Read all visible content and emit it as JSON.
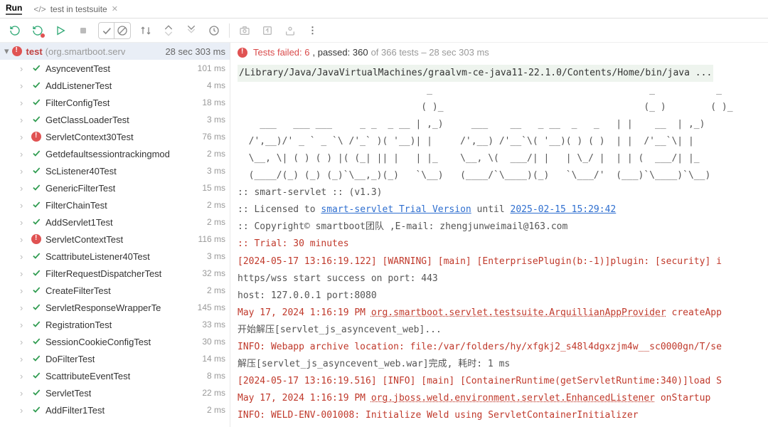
{
  "tabs": {
    "run": "Run",
    "file": "test in testsuite"
  },
  "header": {
    "title": "test",
    "package": "(org.smartboot.serv",
    "time": "28 sec 303 ms"
  },
  "summary": {
    "failed": "Tests failed: 6",
    "passed": ", passed: 360",
    "rest": " of 366 tests – 28 sec 303 ms"
  },
  "tests": [
    {
      "name": "AsynceventTest",
      "time": "101 ms",
      "status": "pass"
    },
    {
      "name": "AddListenerTest",
      "time": "4 ms",
      "status": "pass"
    },
    {
      "name": "FilterConfigTest",
      "time": "18 ms",
      "status": "pass"
    },
    {
      "name": "GetClassLoaderTest",
      "time": "3 ms",
      "status": "pass"
    },
    {
      "name": "ServletContext30Test",
      "time": "76 ms",
      "status": "fail"
    },
    {
      "name": "Getdefaultsessiontrackingmod",
      "time": "2 ms",
      "status": "pass"
    },
    {
      "name": "ScListener40Test",
      "time": "3 ms",
      "status": "pass"
    },
    {
      "name": "GenericFilterTest",
      "time": "15 ms",
      "status": "pass"
    },
    {
      "name": "FilterChainTest",
      "time": "2 ms",
      "status": "pass"
    },
    {
      "name": "AddServlet1Test",
      "time": "2 ms",
      "status": "pass"
    },
    {
      "name": "ServletContextTest",
      "time": "116 ms",
      "status": "fail"
    },
    {
      "name": "ScattributeListener40Test",
      "time": "3 ms",
      "status": "pass"
    },
    {
      "name": "FilterRequestDispatcherTest",
      "time": "32 ms",
      "status": "pass"
    },
    {
      "name": "CreateFilterTest",
      "time": "2 ms",
      "status": "pass"
    },
    {
      "name": "ServletResponseWrapperTe",
      "time": "145 ms",
      "status": "pass"
    },
    {
      "name": "RegistrationTest",
      "time": "33 ms",
      "status": "pass"
    },
    {
      "name": "SessionCookieConfigTest",
      "time": "30 ms",
      "status": "pass"
    },
    {
      "name": "DoFilterTest",
      "time": "14 ms",
      "status": "pass"
    },
    {
      "name": "ScattributeEventTest",
      "time": "8 ms",
      "status": "pass"
    },
    {
      "name": "ServletTest",
      "time": "22 ms",
      "status": "pass"
    },
    {
      "name": "AddFilter1Test",
      "time": "2 ms",
      "status": "pass"
    }
  ],
  "console": {
    "cmd": "/Library/Java/JavaVirtualMachines/graalvm-ce-java11-22.1.0/Contents/Home/bin/java ...",
    "ascii": "                                  _                                       _           _\n                                 ( )_                                    (_ )        ( )_\n    ___   ___ ___     _ _  _ __ | ,_)     ___    __   _ __  _   _   | |    __  | ,_)\n  /',__)/' _ ` _ `\\ /'_` )( '__)| |     /',__) /'__`\\( '__)( ) ( )  | |  /'__`\\| |\n  \\__, \\| ( ) ( ) |( (_| || |   | |_    \\__, \\(  ___/| |   | \\_/ |  | | (  ___/| |_\n  (____/(_) (_) (_)`\\__,_)(_)   `\\__)   (____/`\\____)(_)   `\\___/'  (___)`\\____)`\\__)",
    "l1a": ":: smart-servlet :: (v1.3)",
    "l2a": ":: Licensed to ",
    "l2b": "smart-servlet Trial Version",
    "l2c": " until ",
    "l2d": "2025-02-15 15:29:42",
    "l3": ":: Copyright© smartboot团队 ,E-mail: zhengjunweimail@163.com",
    "l4": ":: Trial: 30 minutes",
    "l5": "[2024-05-17 13:16:19.122] [WARNING] [main] [EnterprisePlugin(b:-1)]plugin: [security] i",
    "l6": "https/wss start success on port: 443",
    "l7": "host: 127.0.0.1 port:8080",
    "l8a": "May 17, 2024 1:16:19 PM ",
    "l8b": "org.smartboot.servlet.testsuite.ArquillianAppProvider",
    "l8c": " createApp",
    "l9": "开始解压[servlet_js_asyncevent_web]...",
    "l10": "INFO: Webapp archive location: file:/var/folders/hy/xfgkj2_s48l4dgxzjm4w__sc0000gn/T/se",
    "l11": "解压[servlet_js_asyncevent_web.war]完成, 耗时: 1 ms",
    "l12": "[2024-05-17 13:16:19.516] [INFO] [main] [ContainerRuntime(getServletRuntime:340)]load S",
    "l13a": "May 17, 2024 1:16:19 PM ",
    "l13b": "org.jboss.weld.environment.servlet.EnhancedListener",
    "l13c": " onStartup",
    "l14": "INFO: WELD-ENV-001008: Initialize Weld using ServletContainerInitializer"
  }
}
